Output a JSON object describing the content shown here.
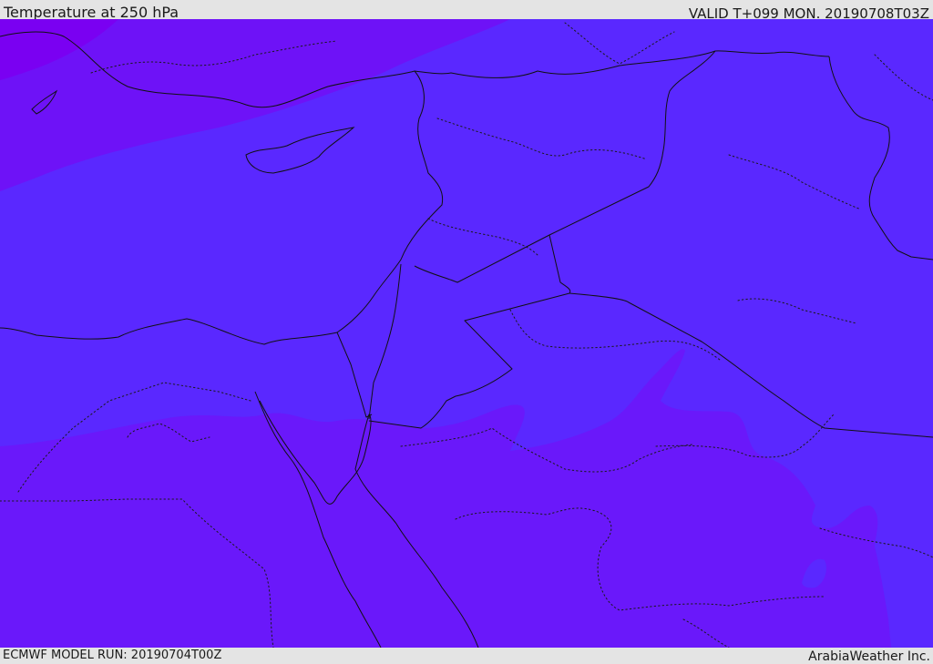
{
  "header": {
    "title": "Temperature at 250 hPa",
    "valid_time": "VALID T+099 MON. 20190708T03Z"
  },
  "footer": {
    "model_run": "ECMWF MODEL RUN: 20190704T00Z",
    "credit": "ArabiaWeather Inc."
  },
  "map": {
    "colors": {
      "frame_bg": "#e4e4e4",
      "band_coldest": "#7a00f2",
      "band_cold": "#6e12f7",
      "band_mid": "#5a28ff",
      "band_south": "#6a18fa",
      "border_line": "#111111"
    }
  }
}
